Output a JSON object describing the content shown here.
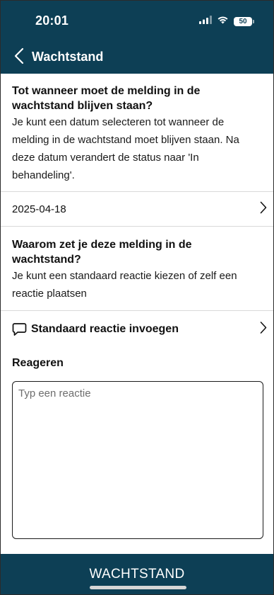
{
  "status_bar": {
    "time": "20:01",
    "battery": "50",
    "icons": [
      "signal-icon",
      "wifi-icon",
      "battery-icon"
    ]
  },
  "nav": {
    "back_icon": "chevron-left-icon",
    "title": "Wachtstand"
  },
  "date_section": {
    "title": "Tot wanneer moet de melding in de wachtstand blijven staan?",
    "body": "Je kunt een datum selecteren tot wanneer de melding in de wachtstand moet blijven staan. Na deze datum verandert de status naar 'In behandeling'.",
    "selected_date": "2025-04-18"
  },
  "reason_section": {
    "title": "Waarom zet je deze melding in de wachtstand?",
    "body": "Je kunt een standaard reactie kiezen of zelf een reactie plaatsen",
    "standard_reply_label": "Standaard reactie invoegen",
    "standard_reply_icon": "speech-bubble-icon"
  },
  "reply": {
    "label": "Reageren",
    "placeholder": "Typ een reactie",
    "value": ""
  },
  "footer": {
    "button_label": "WACHTSTAND"
  },
  "colors": {
    "header_bg": "#0d3f55",
    "footer_bg": "#0d3f55",
    "divider": "#d9d9d9",
    "text": "#111111"
  }
}
